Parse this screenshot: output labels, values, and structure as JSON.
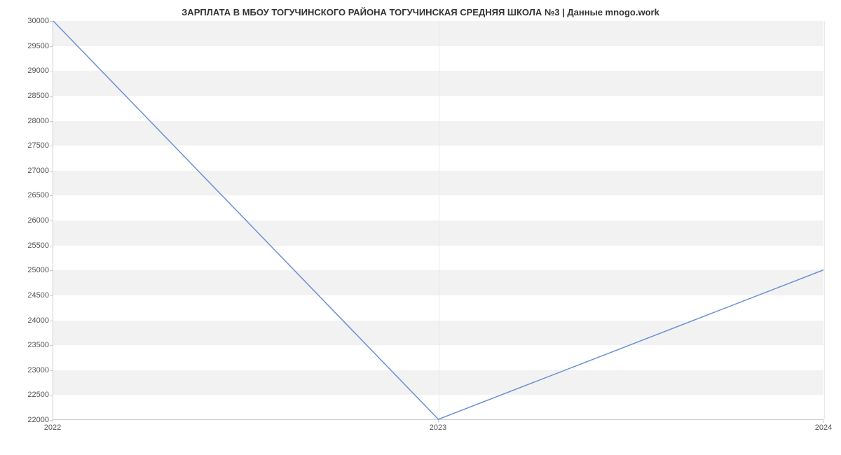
{
  "chart_data": {
    "type": "line",
    "title": "ЗАРПЛАТА В МБОУ ТОГУЧИНСКОГО РАЙОНА ТОГУЧИНСКАЯ СРЕДНЯЯ ШКОЛА №3 | Данные mnogo.work",
    "x": [
      "2022",
      "2023",
      "2024"
    ],
    "values": [
      30000,
      22000,
      25000
    ],
    "xlabel": "",
    "ylabel": "",
    "ylim": [
      22000,
      30000
    ],
    "y_ticks": [
      22000,
      22500,
      23000,
      23500,
      24000,
      24500,
      25000,
      25500,
      26000,
      26500,
      27000,
      27500,
      28000,
      28500,
      29000,
      29500,
      30000
    ],
    "x_ticks": [
      "2022",
      "2023",
      "2024"
    ],
    "line_color": "#6b8fd6"
  }
}
